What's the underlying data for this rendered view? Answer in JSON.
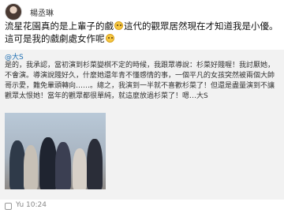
{
  "post": {
    "username": "楊丞琳",
    "main_text_1": "流星花園真的是上輩子的戲",
    "main_text_2": "這代的觀眾居然現在才知道我是小優。這可是我的戲劇處女作呢",
    "avatar_icon": "user-avatar",
    "emoji_icons": [
      "laughing-emoji",
      "smiling-emoji"
    ]
  },
  "quote": {
    "mention": "@大S",
    "text": "是的，我承認，當初演到杉菜變棋不定的時候，我跟眾導說：杉菜好賤喔！我討厭她，不會演。導演說賤好久，什麼她還年青不懂感情的事，一個平凡的女孩突然被兩個大帥哥示愛，難免暈頭轉向……。總之，我演到一半就不喜歡杉菜了！但還是盡量演到不讓觀眾太恨她！當年的觀眾都很單純，就這麼放過杉菜了！嗯…大S",
    "photo_label": "group-photo"
  },
  "footer": {
    "time": "Yu 10:24",
    "clock_icon": "post-icon"
  }
}
